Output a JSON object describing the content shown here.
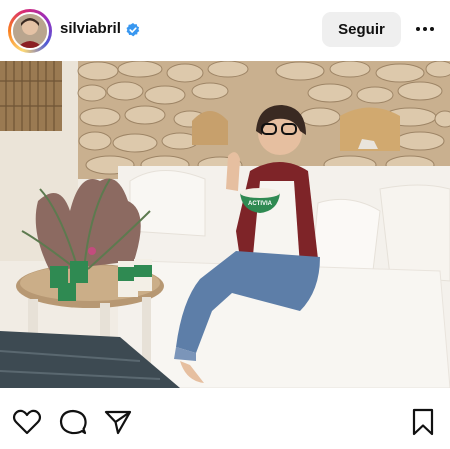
{
  "header": {
    "username": "silviabril",
    "verified": true,
    "follow_label": "Seguir",
    "avatar_icon": "profile-photo",
    "more_icon": "more-horizontal-icon"
  },
  "photo": {
    "product_label": "ACTIVIA"
  },
  "actions": {
    "like_icon": "heart-icon",
    "comment_icon": "comment-icon",
    "share_icon": "send-icon",
    "save_icon": "bookmark-icon"
  },
  "colors": {
    "verified_blue": "#3897f0",
    "button_bg": "#efefef",
    "text": "#111111"
  }
}
